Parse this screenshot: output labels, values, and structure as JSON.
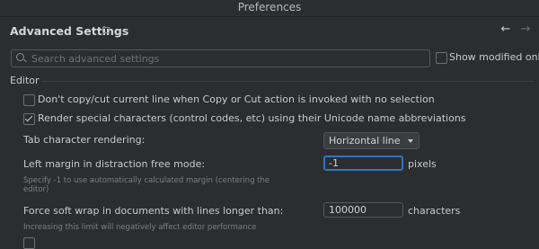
{
  "window": {
    "title": "Preferences"
  },
  "header": {
    "title": "Advanced Settings",
    "pin_icon": "pin-icon",
    "back_icon": "arrow-left-icon",
    "forward_icon": "arrow-right-icon",
    "back_glyph": "←",
    "forward_glyph": "→"
  },
  "search": {
    "placeholder": "Search advanced settings",
    "value": "",
    "icon": "search-icon"
  },
  "show_modified": {
    "label": "Show modified only",
    "checked": false
  },
  "section": {
    "title": "Editor"
  },
  "settings": {
    "dont_copy": {
      "label": "Don't copy/cut current line when Copy or Cut action is invoked with no selection",
      "checked": false
    },
    "render_special": {
      "label": "Render special characters (control codes, etc) using their Unicode name abbreviations",
      "checked": true
    },
    "tab_rendering": {
      "label": "Tab character rendering:",
      "value": "Horizontal line"
    },
    "left_margin": {
      "label": "Left margin in distraction free mode:",
      "value": "-1",
      "unit": "pixels",
      "hint_line1": "Specify -1 to use automatically calculated margin (centering the",
      "hint_line2": "editor)"
    },
    "soft_wrap": {
      "label": "Force soft wrap in documents with lines longer than:",
      "value": "100000",
      "unit": "characters",
      "hint": "Increasing this limit will negatively affect editor performance"
    }
  },
  "colors": {
    "background": "#2b2d30",
    "focus_accent": "#3574c0",
    "text": "#c8cacd",
    "hint_text": "#7d8084"
  }
}
